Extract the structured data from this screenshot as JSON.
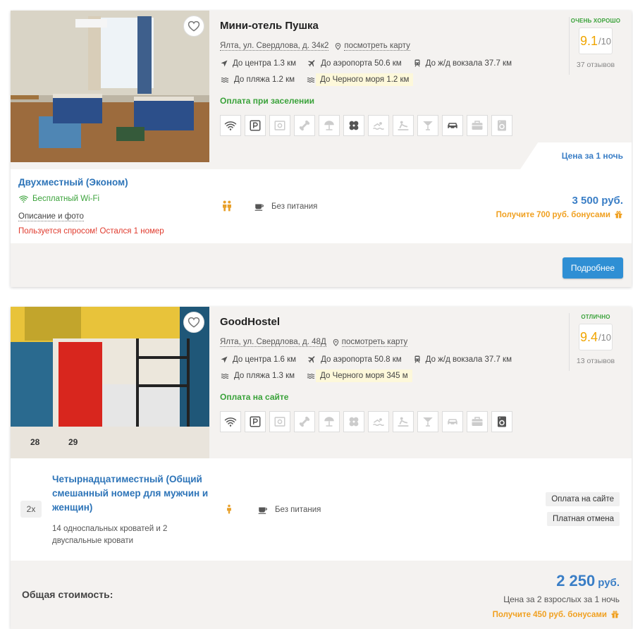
{
  "hotels": [
    {
      "name": "Мини-отель Пушка",
      "address": "Ялта, ул. Свердлова, д. 34к2",
      "map_link": "посмотреть карту",
      "distances": {
        "center": "До центра 1.3 км",
        "airport": "До аэропорта 50.6 км",
        "station": "До ж/д вокзала 37.7 км",
        "beach": "До пляжа 1.2 км",
        "sea": "До Черного моря 1.2 км"
      },
      "payment": "Оплата при заселении",
      "rating_label": "ОЧЕНЬ ХОРОШО",
      "rating_value": "9.1",
      "rating_max": "/10",
      "reviews": "37 отзывов",
      "price_per_night_tab": "Цена за 1 ночь",
      "amenities": [
        "wifi-icon",
        "parking-icon",
        "safe-icon",
        "bone-pet-icon",
        "beach-umbrella-icon",
        "spa-icon",
        "pool-icon",
        "sauna-icon",
        "bar-icon",
        "car-icon",
        "luggage-icon",
        "laundry-icon"
      ],
      "room": {
        "title": "Двухместный (Эконом)",
        "wifi": "Бесплатный Wi-Fi",
        "desc_link": "Описание и фото",
        "demand": "Пользуется спросом! Остался 1 номер",
        "meal": "Без питания",
        "price": "3 500 руб.",
        "bonus": "Получите 700 руб. бонусами"
      },
      "button": "Подробнее"
    },
    {
      "name": "GoodHostel",
      "address": "Ялта, ул. Свердлова, д. 48Д",
      "map_link": "посмотреть карту",
      "distances": {
        "center": "До центра 1.6 км",
        "airport": "До аэропорта 50.8 км",
        "station": "До ж/д вокзала 37.7 км",
        "beach": "До пляжа 1.3 км",
        "sea": "До Черного моря 345 м"
      },
      "payment": "Оплата на сайте",
      "rating_label": "ОТЛИЧНО",
      "rating_value": "9.4",
      "rating_max": "/10",
      "reviews": "13 отзывов",
      "amenities": [
        "wifi-icon",
        "parking-icon",
        "safe-icon",
        "bone-pet-icon",
        "beach-umbrella-icon",
        "spa-icon",
        "pool-icon",
        "sauna-icon",
        "bar-icon",
        "car-icon",
        "luggage-icon",
        "laundry-icon"
      ],
      "room": {
        "qty": "2x",
        "title": "Четырнадцатиместный (Общий смешанный номер для мужчин и женщин)",
        "beds": "14 односпальных кроватей и 2 двуспальные кровати",
        "meal": "Без питания",
        "tag_pay": "Оплата на сайте",
        "tag_cancel": "Платная отмена"
      },
      "total_label": "Общая стоимость:",
      "total_price": "2 250",
      "total_currency": "руб.",
      "total_sub": "Цена за 2 взрослых за 1 ночь",
      "bonus": "Получите 450 руб. бонусами"
    }
  ],
  "colors": {
    "accent": "#3a7ec6",
    "green": "#3aa23a",
    "orange": "#f0a020",
    "red": "#e03b2e",
    "button": "#2f8fd4"
  }
}
